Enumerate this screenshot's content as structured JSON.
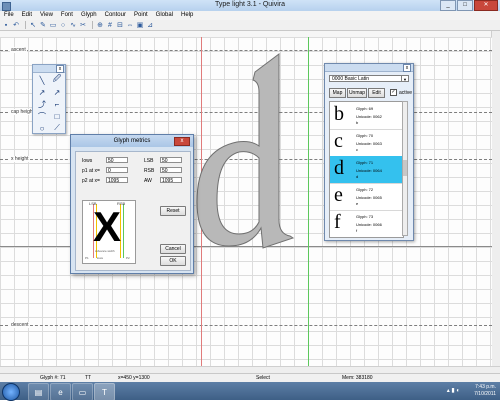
{
  "window": {
    "title": "Type light 3.1 - Quivira"
  },
  "menu": [
    "File",
    "Edit",
    "View",
    "Font",
    "Glyph",
    "Contour",
    "Point",
    "Global",
    "Help"
  ],
  "guides": {
    "ascent": "ascent",
    "cap_height": "cap height",
    "x_height": "x height",
    "descent": "descent"
  },
  "tool_palette": {
    "close": "x"
  },
  "metrics_dialog": {
    "title": "Glyph metrics",
    "close": "x",
    "fields": {
      "lsb_label": "LSB",
      "lsb": "50",
      "rsb_label": "RSB",
      "rsb": "50",
      "aw_label": "AW",
      "aw": "1095",
      "f1_label": "Iows",
      "f1": "50",
      "f2_label": "p1 at x=",
      "f2": "0",
      "f3_label": "p2 at x=",
      "f3": "1095"
    },
    "preview": {
      "glyph": "X",
      "top_left": "LSB",
      "top_right": "RSB",
      "bottom": "Advance width",
      "p1": "P1",
      "p2": "P2",
      "lows": "lows"
    },
    "buttons": {
      "reset": "Reset",
      "cancel": "Cancel",
      "ok": "OK"
    }
  },
  "glyph_panel": {
    "close": "x",
    "range": "0000 Basic Latin",
    "buttons": {
      "map": "Map",
      "unmap": "Unmap",
      "edit": "Edit"
    },
    "active_label": "active",
    "active_check": "✓",
    "items": [
      {
        "char": "b",
        "name": "Glyph: 69",
        "unicode": "Unicode: 0062",
        "letter": "b",
        "selected": false
      },
      {
        "char": "c",
        "name": "Glyph: 70",
        "unicode": "Unicode: 0063",
        "letter": "c",
        "selected": false
      },
      {
        "char": "d",
        "name": "Glyph: 71",
        "unicode": "Unicode: 0064",
        "letter": "d",
        "selected": true
      },
      {
        "char": "e",
        "name": "Glyph: 72",
        "unicode": "Unicode: 0065",
        "letter": "e",
        "selected": false
      },
      {
        "char": "f",
        "name": "Glyph: 73",
        "unicode": "Unicode: 0066",
        "letter": "f",
        "selected": false
      }
    ]
  },
  "status": {
    "glyph": "Glyph #: 71",
    "tt": "TT",
    "coords": "x=450  y=1300",
    "mode": "Select",
    "memory": "Mem: 383180"
  },
  "taskbar": {
    "time": "7:43 p.m.",
    "date": "7/10/2011"
  },
  "colors": {
    "selection": "#34c1ee",
    "guide_red": "#e07b7b",
    "guide_green": "#5cc85c",
    "glyph_fill": "#b8b8b8"
  }
}
